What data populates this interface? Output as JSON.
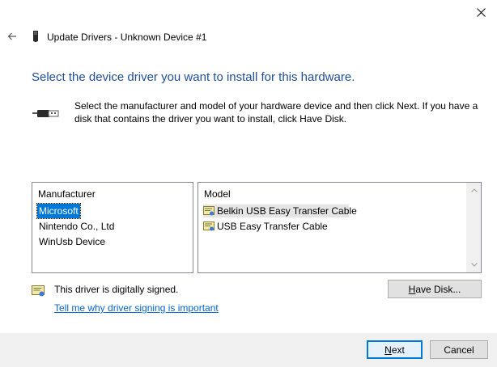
{
  "window": {
    "title": "Update Drivers - Unknown Device #1",
    "close_icon": "close-icon",
    "back_icon": "back-arrow-icon"
  },
  "main": {
    "heading": "Select the device driver you want to install for this hardware.",
    "instructions": "Select the manufacturer and model of your hardware device and then click Next. If you have a disk that contains the driver you want to install, click Have Disk."
  },
  "manufacturer_list": {
    "header": "Manufacturer",
    "items": [
      "Microsoft",
      "Nintendo Co., Ltd",
      "WinUsb Device"
    ],
    "selected": "Microsoft"
  },
  "model_list": {
    "header": "Model",
    "items": [
      "Belkin USB Easy Transfer Cable",
      "USB Easy Transfer Cable"
    ],
    "highlighted": "Belkin USB Easy Transfer Cable"
  },
  "signing": {
    "status": "This driver is digitally signed.",
    "link": "Tell me why driver signing is important"
  },
  "buttons": {
    "have_disk_underline": "H",
    "have_disk_rest": "ave Disk...",
    "next_underline": "N",
    "next_rest": "ext",
    "cancel": "Cancel"
  },
  "colors": {
    "heading": "#1f4e9a",
    "selection": "#0078d7",
    "link": "#0066cc",
    "footer": "#f0f0f0"
  }
}
